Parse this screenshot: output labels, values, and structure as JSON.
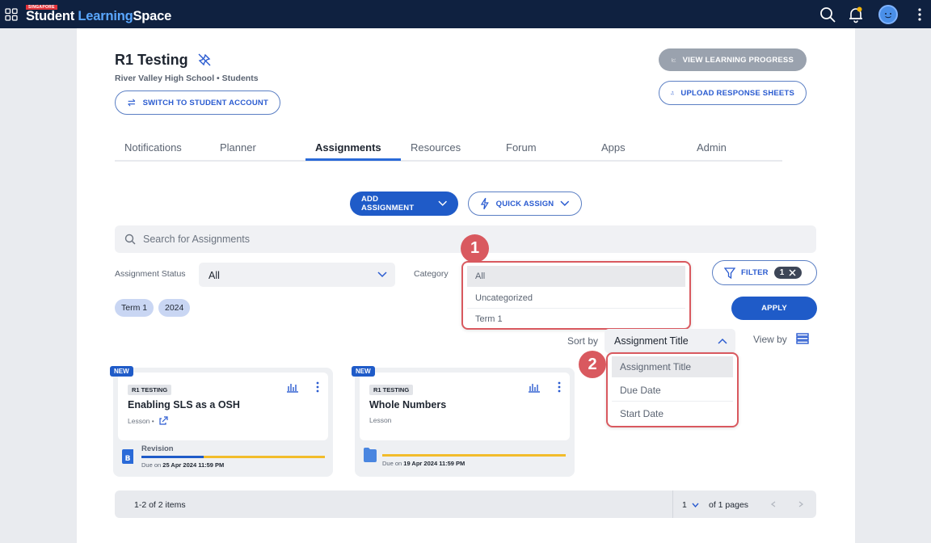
{
  "brand": {
    "tag": "SINGAPORE",
    "name_1": "Student ",
    "name_2": "Learning",
    "name_3": "Space"
  },
  "topbar": {
    "icons": [
      "apps-grid-icon",
      "search-icon",
      "bell-icon",
      "avatar",
      "more-vertical-icon"
    ]
  },
  "header": {
    "title": "R1 Testing",
    "subtitle": "River Valley High School • Students",
    "switch_label": "SWITCH TO STUDENT ACCOUNT",
    "view_progress_label": "VIEW LEARNING PROGRESS",
    "upload_label": "UPLOAD RESPONSE SHEETS"
  },
  "tabs": [
    "Notifications",
    "Planner",
    "Assignments",
    "Resources",
    "Forum",
    "Apps",
    "Admin"
  ],
  "active_tab": "Assignments",
  "actions": {
    "add_label": "ADD ASSIGNMENT",
    "quick_label": "QUICK ASSIGN"
  },
  "search": {
    "placeholder": "Search for Assignments"
  },
  "filters": {
    "status_label": "Assignment Status",
    "status_value": "All",
    "category_label": "Category",
    "filter_label": "FILTER",
    "filter_count": "1",
    "apply_label": "APPLY",
    "chips": [
      "Term 1",
      "2024"
    ]
  },
  "category_dropdown": {
    "badge": "1",
    "options": [
      "All",
      "Uncategorized",
      "Term 1"
    ],
    "selected": "All"
  },
  "sort": {
    "label": "Sort by",
    "value": "Assignment Title",
    "view_label": "View by",
    "badge": "2",
    "options": [
      "Assignment Title",
      "Due Date",
      "Start Date"
    ]
  },
  "cards": [
    {
      "flag": "NEW",
      "tag": "R1 TESTING",
      "title": "Enabling SLS as a OSH",
      "type": "Lesson •",
      "foot_label": "Revision",
      "due_prefix": "Due on ",
      "due_date": "25 Apr 2024 11:59 PM",
      "progress": 0.34
    },
    {
      "flag": "NEW",
      "tag": "R1 TESTING",
      "title": "Whole Numbers",
      "type": "Lesson",
      "foot_label": "",
      "due_prefix": "Due on ",
      "due_date": "19 Apr 2024 11:59 PM",
      "progress": 0
    }
  ],
  "pagination": {
    "summary": "1-2 of 2 items",
    "page": "1",
    "of_pages": "of 1 pages"
  },
  "colors": {
    "primary": "#1f5bc8",
    "navy": "#0f2140",
    "highlight": "#d9595f",
    "progress_track": "#f2bc2b"
  }
}
